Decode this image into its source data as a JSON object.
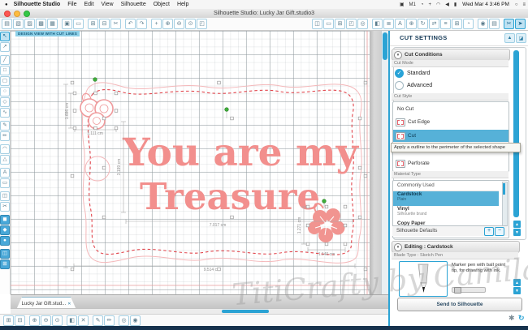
{
  "menu_bar": {
    "app_menu": "Silhouette Studio",
    "items": [
      "File",
      "Edit",
      "View",
      "Silhouette",
      "Object",
      "Help"
    ],
    "status_icons": [
      {
        "name": "shield-status-icon",
        "glyph": "▣"
      },
      {
        "name": "m1-status-icon",
        "glyph": "M1"
      },
      {
        "name": "time-machine-icon",
        "glyph": "◔"
      },
      {
        "name": "fan-status-icon",
        "glyph": "+"
      },
      {
        "name": "wifi-icon",
        "glyph": "◠"
      },
      {
        "name": "volume-icon",
        "glyph": "◀"
      },
      {
        "name": "battery-icon",
        "glyph": "▮"
      }
    ],
    "clock": "Wed Mar 4 3:46 PM",
    "trailing_icons": [
      {
        "name": "spotlight-icon",
        "glyph": "○"
      },
      {
        "name": "notification-center-icon",
        "glyph": "≡"
      }
    ]
  },
  "title_bar": {
    "title": "Silhouette Studio: Lucky Jar Gift.studio3"
  },
  "toolbars": {
    "top_left": [
      {
        "name": "new-document-icon",
        "glyph": "▤"
      },
      {
        "name": "open-icon",
        "glyph": "▧"
      },
      {
        "name": "open-recent-icon",
        "glyph": "▨"
      },
      {
        "name": "library-icon",
        "glyph": "▩"
      },
      {
        "name": "save-icon",
        "glyph": "▦"
      },
      {
        "name": "print-icon",
        "glyph": "▣",
        "gap": true
      },
      {
        "name": "cut-mat-icon",
        "glyph": "▭"
      },
      {
        "name": "copy-icon",
        "glyph": "⊞",
        "gap": true
      },
      {
        "name": "paste-icon",
        "glyph": "⊟"
      },
      {
        "name": "scissors-icon",
        "glyph": "✂"
      },
      {
        "name": "undo-icon",
        "glyph": "↶",
        "gap": true
      },
      {
        "name": "redo-icon",
        "glyph": "↷"
      },
      {
        "name": "pan-icon",
        "glyph": "+",
        "gap": true
      },
      {
        "name": "zoom-in-icon",
        "glyph": "⊕"
      },
      {
        "name": "zoom-out-icon",
        "glyph": "⊖"
      },
      {
        "name": "zoom-select-icon",
        "glyph": "⊙"
      },
      {
        "name": "fit-page-icon",
        "glyph": "◰"
      }
    ],
    "top_right": [
      {
        "name": "document-tools-icon",
        "glyph": "◫"
      },
      {
        "name": "page-setup-icon",
        "glyph": "▭"
      },
      {
        "name": "grid-settings-icon",
        "glyph": "⊞"
      },
      {
        "name": "reg-marks-icon",
        "glyph": "◰"
      },
      {
        "name": "offset-panel-icon",
        "glyph": "◎"
      },
      {
        "name": "fill-color-icon",
        "glyph": "◧",
        "gap": true
      },
      {
        "name": "line-style-icon",
        "glyph": "≣"
      },
      {
        "name": "text-style-icon",
        "glyph": "A"
      },
      {
        "name": "transform-icon",
        "glyph": "⊕"
      },
      {
        "name": "rotate-icon",
        "glyph": "↻"
      },
      {
        "name": "scale-icon",
        "glyph": "⇄"
      },
      {
        "name": "align-icon",
        "glyph": "≡"
      },
      {
        "name": "replicate-icon",
        "glyph": "⊞"
      },
      {
        "name": "modify-icon",
        "glyph": "◔"
      },
      {
        "name": "trace-icon",
        "glyph": "◉",
        "gap": true
      },
      {
        "name": "library-panel-icon",
        "glyph": "▤"
      },
      {
        "name": "cut-settings-icon",
        "glyph": "✂",
        "active": true,
        "gap": true
      },
      {
        "name": "send-to-silhouette-icon",
        "glyph": "➤",
        "active": true
      }
    ],
    "left_palette": [
      {
        "name": "select-tool-icon",
        "glyph": "↖",
        "active": true
      },
      {
        "name": "edit-points-tool-icon",
        "glyph": "↗"
      },
      {
        "name": "line-tool-icon",
        "glyph": "╱",
        "gap": true
      },
      {
        "name": "rectangle-tool-icon",
        "glyph": "□"
      },
      {
        "name": "rounded-rectangle-tool-icon",
        "glyph": "▢"
      },
      {
        "name": "ellipse-tool-icon",
        "glyph": "○"
      },
      {
        "name": "polygon-tool-icon",
        "glyph": "◇"
      },
      {
        "name": "curve-tool-icon",
        "glyph": "∿"
      },
      {
        "name": "freehand-tool-icon",
        "glyph": "✎",
        "gap": true
      },
      {
        "name": "smooth-freehand-tool-icon",
        "glyph": "✏"
      },
      {
        "name": "arc-tool-icon",
        "glyph": "◠",
        "gap": true
      },
      {
        "name": "regular-polygon-tool-icon",
        "glyph": "△"
      },
      {
        "name": "text-tool-icon",
        "glyph": "A",
        "gap": true
      },
      {
        "name": "note-tool-icon",
        "glyph": "▭"
      },
      {
        "name": "eraser-tool-icon",
        "glyph": "◫",
        "gap": true
      },
      {
        "name": "knife-tool-icon",
        "glyph": "✂"
      },
      {
        "name": "shadow-tool-icon",
        "glyph": "◼",
        "gap": true,
        "blue": true
      },
      {
        "name": "stamp-tool-icon",
        "glyph": "◆",
        "blue": true
      },
      {
        "name": "sphere-tool-icon",
        "glyph": "●",
        "blue": true
      },
      {
        "name": "mat-preview-icon",
        "glyph": "◫",
        "gap": true,
        "blue": true
      },
      {
        "name": "grid-toggle-icon",
        "glyph": "⊞",
        "blue": true
      }
    ],
    "bottom": [
      {
        "name": "select-all-icon",
        "glyph": "⊞"
      },
      {
        "name": "deselect-all-icon",
        "glyph": "⊟"
      },
      {
        "name": "zoom-in-2-icon",
        "glyph": "⊕",
        "gap": true
      },
      {
        "name": "zoom-out-2-icon",
        "glyph": "⊖"
      },
      {
        "name": "zoom-selection-icon",
        "glyph": "⊙"
      },
      {
        "name": "duplicate-icon",
        "glyph": "◧",
        "gap": true
      },
      {
        "name": "delete-icon",
        "glyph": "✕"
      },
      {
        "name": "fill-tool-icon",
        "glyph": "✎",
        "gap": true
      },
      {
        "name": "line-tool-2-icon",
        "glyph": "✏"
      },
      {
        "name": "offset-2-icon",
        "glyph": "◎",
        "gap": true
      },
      {
        "name": "trace-2-icon",
        "glyph": "◉"
      }
    ]
  },
  "canvas": {
    "view_badge": "DESIGN VIEW WITH CUT LINES",
    "design_text": {
      "line1": "You are my",
      "line2": "Treasure"
    },
    "measurements": {
      "flower_top_w": "1.111 cm",
      "flower_top_h": "1.686 cm",
      "text_h": "3.199 cm",
      "text_w": "7.017 cm",
      "frame_w": "9.514 cm",
      "flower_bottom_h": "1.271 cm",
      "flower_bottom_w": "1.140 cm"
    }
  },
  "panel": {
    "title": "CUT SETTINGS",
    "collapse_glyph": "▲",
    "pin_glyph": "◪",
    "cut_conditions": {
      "header": "Cut Conditions",
      "cut_mode_label": "Cut Mode",
      "radio_standard": "Standard",
      "radio_advanced": "Advanced",
      "check_glyph": "✓",
      "cut_style_label": "Cut Style",
      "styles": [
        {
          "label": "No Cut"
        },
        {
          "label": "Cut Edge"
        },
        {
          "label": "Cut"
        },
        {
          "label": "Perforate"
        }
      ],
      "tooltip": "Apply a outline to the perimeter of the selected shape"
    },
    "material": {
      "label": "Material Type",
      "group_header": "Commonly Used",
      "items": [
        {
          "name": "Cardstock",
          "sub": "Plain"
        },
        {
          "name": "Vinyl",
          "sub": "Silhouette brand"
        },
        {
          "name": "Copy Paper",
          "sub": ""
        }
      ],
      "defaults": "Silhouette Defaults",
      "add_label": "+",
      "remove_label": "−"
    },
    "editing": {
      "header": "Editing : Cardstock",
      "blade_label": "Blade Type : Sketch Pen",
      "description": "Marker pen with ball point tip, for drawing with ink."
    },
    "send_button": "Send to Silhouette"
  },
  "bottom_bar": {
    "tab": "Lucky Jar Gift.stud...",
    "close_glyph": "✕"
  },
  "watermark": {
    "text": "TitiCrafty by Camila"
  },
  "colors": {
    "accent_blue": "#2ba3d4",
    "selection_blue": "#56b1d8",
    "coral_text": "#f28f8d",
    "cut_line_red": "#e2474e",
    "frame_pink": "#f4b8ba",
    "bottom_strip_navy": "#16324d"
  }
}
